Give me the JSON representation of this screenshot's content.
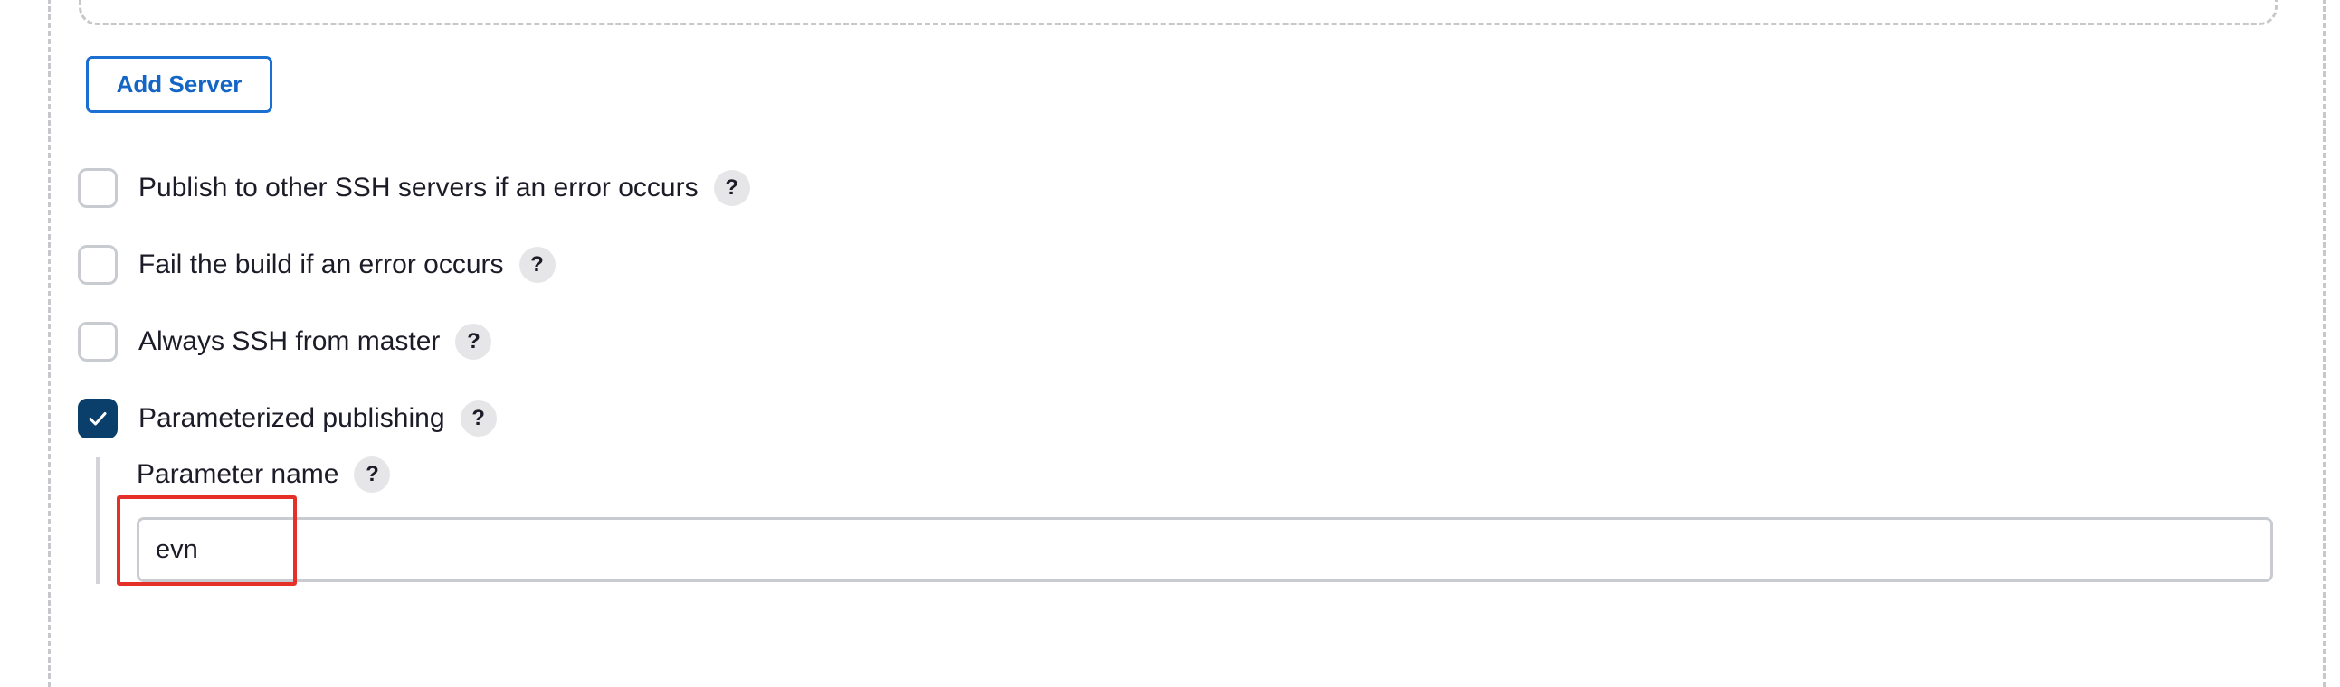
{
  "add_server": {
    "label": "Add Server"
  },
  "options": [
    {
      "label": "Publish to other SSH servers if an error occurs",
      "checked": false,
      "help_icon": "help-icon"
    },
    {
      "label": "Fail the build if an error occurs",
      "checked": false,
      "help_icon": "help-icon"
    },
    {
      "label": "Always SSH from master",
      "checked": false,
      "help_icon": "help-icon"
    },
    {
      "label": "Parameterized publishing",
      "checked": true,
      "help_icon": "help-icon"
    }
  ],
  "parameter_name": {
    "label": "Parameter name",
    "value": "evn"
  },
  "help_glyph": "?",
  "colors": {
    "accent": "#1a6fd1",
    "checked_bg": "#0b3f6b",
    "annotation": "#e5302a"
  }
}
